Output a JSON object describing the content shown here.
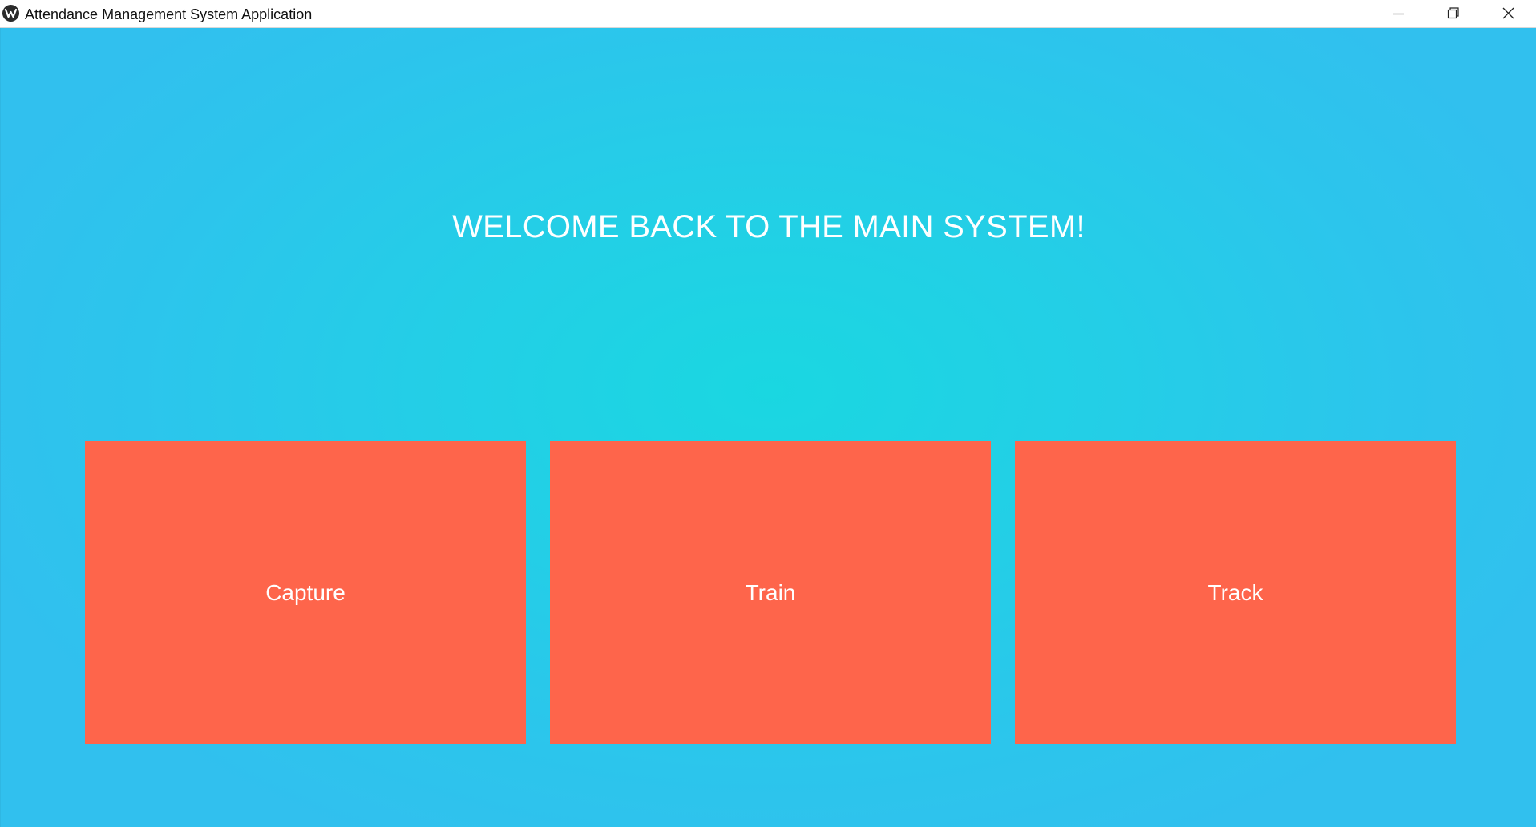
{
  "window": {
    "title": "Attendance Management System Application",
    "controls": {
      "minimize_icon": "minimize-icon",
      "maximize_icon": "restore-icon",
      "close_icon": "close-icon"
    }
  },
  "main": {
    "heading": "WELCOME BACK TO THE MAIN SYSTEM!",
    "buttons": [
      {
        "label": "Capture"
      },
      {
        "label": "Train"
      },
      {
        "label": "Track"
      }
    ]
  },
  "colors": {
    "background_center": "#1ad7e1",
    "background_edge": "#31c0ee",
    "button": "#fe654b",
    "text": "#ffffff"
  }
}
